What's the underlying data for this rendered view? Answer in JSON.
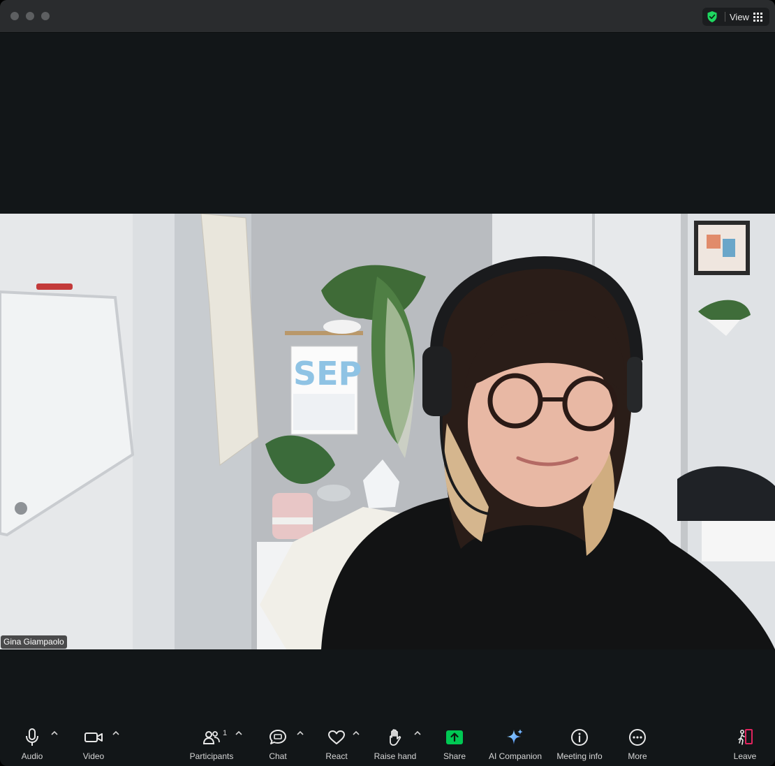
{
  "titlebar": {
    "view_label": "View",
    "icons": [
      "shield-check-icon",
      "grid-icon"
    ],
    "accent_green": "#1ed760"
  },
  "video": {
    "participant_name": "Gina Giampaolo",
    "calendar_text": "SEP"
  },
  "toolbar": {
    "audio_label": "Audio",
    "video_label": "Video",
    "participants_label": "Participants",
    "participants_count": "1",
    "chat_label": "Chat",
    "react_label": "React",
    "raise_hand_label": "Raise hand",
    "share_label": "Share",
    "ai_companion_label": "AI Companion",
    "meeting_info_label": "Meeting info",
    "more_label": "More",
    "leave_label": "Leave",
    "share_color": "#00c853",
    "leave_color": "#e0245e"
  }
}
